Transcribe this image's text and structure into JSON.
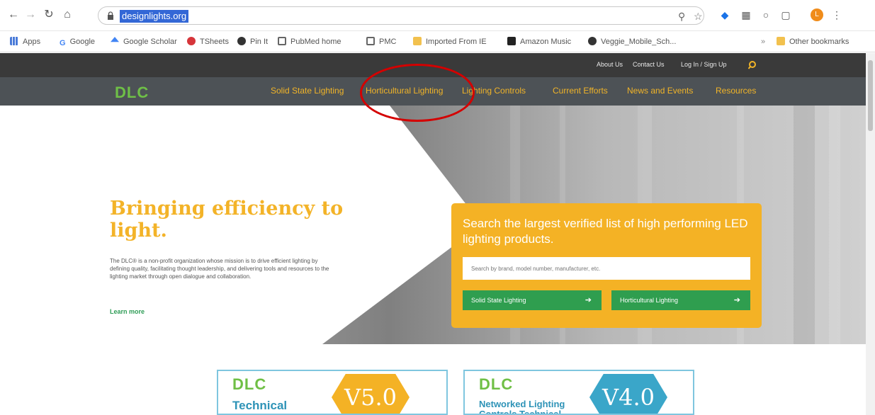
{
  "browser": {
    "url": "designlights.org",
    "icons": [
      "back-icon",
      "forward-icon",
      "reload-icon",
      "home-icon",
      "lock-icon",
      "zoom-icon",
      "star-icon",
      "menu-icon"
    ]
  },
  "bookmarks": [
    "Apps",
    "Google",
    "Google Scholar",
    "TSheets",
    "Pin It",
    "PubMed home",
    "PMC",
    "Imported From IE",
    "Amazon Music",
    "Veggie_Mobile_Sch...",
    "Other bookmarks"
  ],
  "site": {
    "util_links": [
      "About Us",
      "Contact Us",
      "Log In / Sign Up"
    ],
    "logo": "DLC",
    "nav": [
      "Solid State Lighting",
      "Horticultural Lighting",
      "Lighting Controls",
      "Current Efforts",
      "News and Events",
      "Resources"
    ],
    "hero": {
      "title": "Bringing efficiency to light.",
      "description": "The DLC® is a non-profit organization whose mission is to drive efficient lighting by defining quality, facilitating thought leadership, and delivering tools and resources to the lighting market through open dialogue and collaboration.",
      "learn_more": "Learn more"
    },
    "search": {
      "heading": "Search the largest verified list of high performing LED lighting products.",
      "placeholder": "Search by brand, model number, manufacturer, etc.",
      "buttons": [
        "Solid State Lighting",
        "Horticultural Lighting"
      ]
    },
    "cards": [
      {
        "logo": "DLC",
        "subtitle": "Technical",
        "version": "V5.0",
        "color": "#f4b225"
      },
      {
        "logo": "DLC",
        "subtitle": "Networked Lighting Controls Technical",
        "version": "V4.0",
        "color": "#3aa6c9"
      }
    ]
  },
  "colors": {
    "accent": "#f4b225",
    "green": "#2f9e4f",
    "nav_bg": "#4d5256",
    "annotation": "#d40000"
  }
}
